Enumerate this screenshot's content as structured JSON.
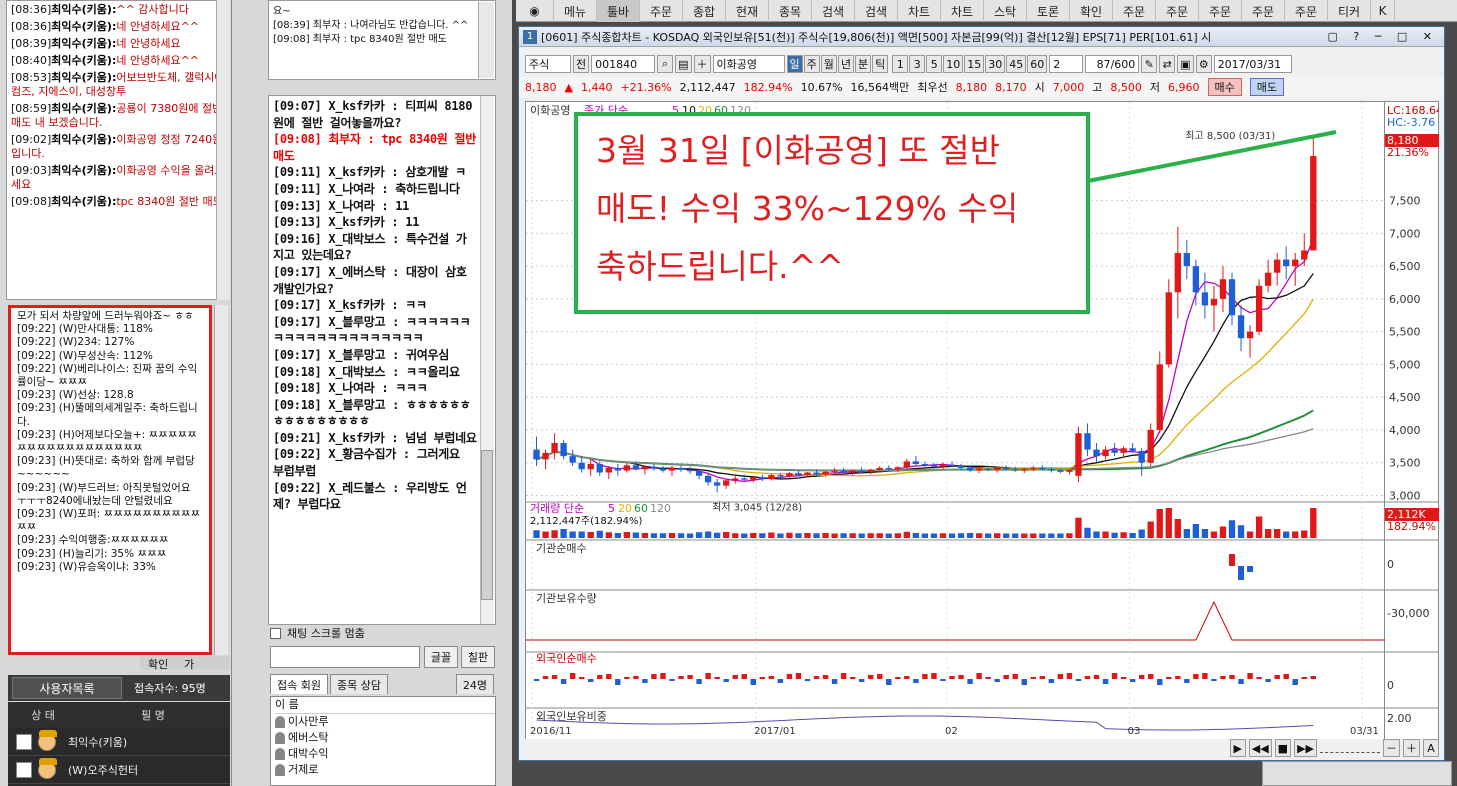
{
  "left_chat": {
    "messages": [
      {
        "time": "[08:36]",
        "name": "최익수(키움):",
        "text": "^^ 감사합니다"
      },
      {
        "time": "[08:36]",
        "name": "최익수(키움):",
        "text": "네 안녕하세요^^"
      },
      {
        "time": "[08:39]",
        "name": "최익수(키움):",
        "text": "네 안녕하세요"
      },
      {
        "time": "[08:40]",
        "name": "최익수(키움):",
        "text": "네 안녕하세요^^"
      },
      {
        "time": "[08:53]",
        "name": "최익수(키움):",
        "text": "어보브반도체, 갤럭시아컴즈, 지에스이, 대성창투"
      },
      {
        "time": "[08:59]",
        "name": "최익수(키움):",
        "text": "공룡이 7380원에 절반 매도 내 보겠습니다."
      },
      {
        "time": "[09:02]",
        "name": "최익수(키움):",
        "text": "이화공영 정정 7240원 입니다."
      },
      {
        "time": "[09:03]",
        "name": "최익수(키움):",
        "text": "이화공영 수익을 올려보세요"
      },
      {
        "time": "[09:08]",
        "name": "최익수(키움):",
        "text": "tpc 8340원 절반 매도"
      }
    ]
  },
  "highlight_chat": {
    "messages": [
      "모가 되서 차량앞에 드러누워야죠~ ㅎㅎ",
      "[09:22] (W)만사대통: 118%",
      "[09:22] (W)234: 127%",
      "[09:22] (W)무성산속: 112%",
      "[09:22] (W)베리나이스: 진짜 꿈의 수익률이당~ ㅉㅉㅉ",
      "[09:23] (W)선상: 128.8",
      "[09:23] (H)뚤메의세계일주: 축하드립니다.",
      "[09:23] (H)어제보다오늘+: ㅉㅉㅉㅉㅉㅉㅉㅉㅉㅉㅉㅉㅉㅉㅉㅉㅉㅉ",
      "[09:23] (H)뜻대로: 축하와 함께 부럽당~~~~~~",
      "[09:23] (W)부드러브: 아직못털었어요 ㅜㅜㅜ8240에내놨는데 안털렸네요",
      "[09:23] (W)포퍼: ㅉㅉㅉㅉㅉㅉㅉㅉㅉㅉㅉㅉ",
      "[09:23] 수익여행중:ㅉㅉㅉㅉㅉㅉ",
      "[09:23] (H)늘리기: 35% ㅉㅉㅉ",
      "[09:23] (W)유승옥이냐: 33%"
    ]
  },
  "user_panel": {
    "tab": "사용자목록",
    "count": "접속자수: 95명",
    "col_status": "상 태",
    "col_name": "필 명",
    "users": [
      "최익수(키움)",
      "(W)오주식헌터"
    ],
    "btn_a": "확인",
    "btn_b": "가"
  },
  "mid_top_chat": {
    "lines": [
      "요~",
      "[08:39] 최부자 : 나여라님도 반갑습니다. ^^",
      "[09:08] 최부자 : tpc 8340원 절반 매도"
    ]
  },
  "mid_chat": {
    "lines": [
      {
        "t": "[09:07] X_ksf카카 : 티피씨 8180원에 절반 걸어놓을까요?",
        "red": false
      },
      {
        "t": "[09:08] 최부자 : tpc 8340원 절반 매도",
        "red": true
      },
      {
        "t": "[09:11] X_ksf카카 : 삼호개발 ㅋ",
        "red": false
      },
      {
        "t": "[09:11] X_나여라 : 축하드립니다",
        "red": false
      },
      {
        "t": "[09:13] X_나여라 : 11",
        "red": false
      },
      {
        "t": "[09:13] X_ksf카카 : 11",
        "red": false
      },
      {
        "t": "[09:16] X_대박보스 : 특수건설 가지고 있는데요?",
        "red": false
      },
      {
        "t": "[09:17] X_에버스탁 : 대장이 삼호개발인가요?",
        "red": false
      },
      {
        "t": "[09:17] X_ksf카카 : ㅋㅋ",
        "red": false
      },
      {
        "t": "[09:17] X_블루망고 : ㅋㅋㅋㅋㅋㅋㅋㅋㅋㅋㅋㅋㅋㅋㅋㅋㅋㅋㅋㅋ",
        "red": false
      },
      {
        "t": "[09:17] X_블루망고 : 귀여우심",
        "red": false
      },
      {
        "t": "[09:18] X_대박보스 : ㅋㅋ올리요",
        "red": false
      },
      {
        "t": "[09:18] X_나여라 : ㅋㅋㅋ",
        "red": false
      },
      {
        "t": "[09:18] X_블루망고 : ㅎㅎㅎㅎㅎㅎㅎㅎㅎㅎㅎㅎㅎㅎㅎ",
        "red": false
      },
      {
        "t": "[09:21] X_ksf카카 : 넘넘 부럽네요",
        "red": false
      },
      {
        "t": "[09:22] X_황금수집가 : 그러게요 부럽부럽",
        "red": false
      },
      {
        "t": "[09:22] X_레드불스 : 우리방도 언제? 부럽다요",
        "red": false
      }
    ]
  },
  "chat_controls": {
    "lock_label": "채팅 스크롤 멈춤",
    "btn_font": "글꼴",
    "btn_board": "칠판",
    "tab_members": "접속 회원",
    "tab_consult": "종목 상담",
    "member_count": "24명",
    "member_header": "이 름",
    "members": [
      "이사만루",
      "에버스탁",
      "대박수익",
      "거제로"
    ]
  },
  "top_menu": {
    "items": [
      "메뉴",
      "툴바",
      "주문",
      "종합",
      "현재",
      "종목",
      "검색",
      "검색",
      "차트",
      "차트",
      "스탁",
      "토론",
      "확인",
      "주문",
      "주문",
      "주문",
      "주문",
      "주문",
      "티커",
      "K"
    ]
  },
  "chart_window": {
    "title": "[0601] 주식종합차트 - KOSDAQ 외국인보유[51(천)] 주식수[19,806(천)] 액면[500] 자본금[99(억)] 결산[12월] EPS[71] PER[101.61] 시",
    "win_num": "1",
    "toolbar": {
      "type": "주식",
      "prev": "전",
      "code": "001840",
      "stock": "이화공영",
      "periods": [
        "일",
        "주",
        "월",
        "년",
        "분",
        "틱"
      ],
      "nums": [
        "1",
        "3",
        "5",
        "10",
        "15",
        "30",
        "45",
        "60"
      ],
      "sel": "2",
      "count": "87/600",
      "date": "2017/03/31"
    },
    "quote": {
      "price": "8,180",
      "change": "1,440",
      "pct": "+21.36%",
      "volume": "2,112,447",
      "vol_pct": "182.94%",
      "turnover": "10.67%",
      "mcap": "16,564백만",
      "bid_label": "최우선",
      "bid1": "8,180",
      "bid2": "8,170",
      "open_label": "시",
      "open": "7,000",
      "high_label": "고",
      "high": "8,500",
      "low_label": "저",
      "low": "6,960",
      "buy": "매수",
      "sell": "매도"
    },
    "price_panel": {
      "label": "이화공영",
      "ma_label": "종가 단순",
      "ma5": "5",
      "ma10": "10",
      "ma20": "20",
      "ma60": "60",
      "ma120": "120",
      "high_note": "최고 8,500 (03/31)",
      "low_note": "최저 3,045 (12/28)",
      "lc": "LC:168.64",
      "hc": "HC:-3.76",
      "cur": "8,180",
      "cur_pct": "21.36%"
    },
    "vol_panel": {
      "label": "거래량 단순",
      "ma5": "5",
      "ma20": "20",
      "ma60": "60",
      "ma120": "120",
      "value": "2,112,447주(182.94%)",
      "cur": "2,112K",
      "cur_pct": "182.94%"
    },
    "panels": [
      "기관순매수",
      "기관보유수량",
      "외국인순매수",
      "외국인보유비중"
    ],
    "panel_ticks": [
      "0",
      "-30,000",
      "0",
      "2.00"
    ],
    "x_labels": [
      "2016/11",
      "2017/01",
      "02",
      "03",
      "03/31"
    ],
    "callout": [
      "3월 31일 [이화공영] 또 절반",
      "매도! 수익 33%~129% 수익",
      "축하드립니다.^^"
    ]
  },
  "colors": {
    "up": "#e01818",
    "down": "#1f5fd6",
    "callout_border": "#2bb04a",
    "callout_text": "#e02020",
    "highlight": "#e41b1b"
  },
  "chart_data": {
    "type": "candlestick",
    "title": "이화공영",
    "ylim": [
      2900,
      8700
    ],
    "y_ticks": [
      3000,
      3500,
      4000,
      4500,
      5000,
      5500,
      6000,
      6500,
      7000,
      7500
    ],
    "x_ticks": [
      "2016/11",
      "2017/01",
      "02",
      "03",
      "03/31"
    ],
    "candles": [
      [
        3700,
        3900,
        3450,
        3550
      ],
      [
        3550,
        3700,
        3400,
        3650
      ],
      [
        3650,
        3950,
        3550,
        3800
      ],
      [
        3800,
        3850,
        3550,
        3600
      ],
      [
        3600,
        3700,
        3450,
        3500
      ],
      [
        3500,
        3600,
        3350,
        3400
      ],
      [
        3400,
        3550,
        3300,
        3480
      ],
      [
        3480,
        3520,
        3300,
        3350
      ],
      [
        3350,
        3450,
        3250,
        3420
      ],
      [
        3420,
        3480,
        3300,
        3380
      ],
      [
        3380,
        3500,
        3350,
        3460
      ],
      [
        3460,
        3520,
        3380,
        3400
      ],
      [
        3400,
        3460,
        3320,
        3440
      ],
      [
        3440,
        3480,
        3380,
        3410
      ],
      [
        3410,
        3450,
        3350,
        3380
      ],
      [
        3380,
        3450,
        3300,
        3420
      ],
      [
        3420,
        3460,
        3360,
        3390
      ],
      [
        3390,
        3440,
        3330,
        3370
      ],
      [
        3370,
        3400,
        3250,
        3300
      ],
      [
        3300,
        3350,
        3150,
        3200
      ],
      [
        3200,
        3250,
        3045,
        3150
      ],
      [
        3150,
        3250,
        3100,
        3230
      ],
      [
        3230,
        3300,
        3180,
        3260
      ],
      [
        3260,
        3320,
        3200,
        3240
      ],
      [
        3240,
        3300,
        3200,
        3280
      ],
      [
        3280,
        3320,
        3220,
        3250
      ],
      [
        3250,
        3330,
        3230,
        3310
      ],
      [
        3310,
        3340,
        3260,
        3290
      ],
      [
        3290,
        3360,
        3270,
        3340
      ],
      [
        3340,
        3380,
        3290,
        3310
      ],
      [
        3310,
        3360,
        3280,
        3350
      ],
      [
        3350,
        3400,
        3300,
        3320
      ],
      [
        3320,
        3370,
        3290,
        3360
      ],
      [
        3360,
        3420,
        3320,
        3380
      ],
      [
        3380,
        3420,
        3330,
        3350
      ],
      [
        3350,
        3400,
        3300,
        3380
      ],
      [
        3380,
        3430,
        3340,
        3360
      ],
      [
        3360,
        3410,
        3320,
        3390
      ],
      [
        3390,
        3450,
        3350,
        3420
      ],
      [
        3420,
        3460,
        3370,
        3400
      ],
      [
        3400,
        3450,
        3360,
        3430
      ],
      [
        3430,
        3560,
        3400,
        3520
      ],
      [
        3520,
        3600,
        3450,
        3480
      ],
      [
        3480,
        3520,
        3420,
        3460
      ],
      [
        3460,
        3500,
        3400,
        3440
      ],
      [
        3440,
        3500,
        3400,
        3470
      ],
      [
        3470,
        3520,
        3430,
        3450
      ],
      [
        3450,
        3480,
        3380,
        3420
      ],
      [
        3420,
        3460,
        3360,
        3380
      ],
      [
        3380,
        3430,
        3340,
        3410
      ],
      [
        3410,
        3450,
        3370,
        3390
      ],
      [
        3390,
        3440,
        3350,
        3420
      ],
      [
        3420,
        3460,
        3380,
        3400
      ],
      [
        3400,
        3440,
        3360,
        3380
      ],
      [
        3380,
        3420,
        3340,
        3400
      ],
      [
        3400,
        3450,
        3370,
        3420
      ],
      [
        3420,
        3460,
        3380,
        3400
      ],
      [
        3400,
        3430,
        3350,
        3380
      ],
      [
        3380,
        3410,
        3340,
        3360
      ],
      [
        3360,
        3400,
        3320,
        3390
      ],
      [
        3300,
        4050,
        3200,
        3950
      ],
      [
        3950,
        4100,
        3600,
        3700
      ],
      [
        3700,
        3800,
        3500,
        3600
      ],
      [
        3600,
        3750,
        3550,
        3700
      ],
      [
        3700,
        3800,
        3600,
        3650
      ],
      [
        3650,
        3750,
        3580,
        3720
      ],
      [
        3720,
        3800,
        3650,
        3680
      ],
      [
        3680,
        3720,
        3300,
        3500
      ],
      [
        3500,
        4100,
        3450,
        4000
      ],
      [
        4000,
        5200,
        3950,
        5000
      ],
      [
        5000,
        6300,
        4950,
        6100
      ],
      [
        6100,
        7100,
        5700,
        6700
      ],
      [
        6700,
        6900,
        6300,
        6500
      ],
      [
        6500,
        6600,
        5900,
        6100
      ],
      [
        6100,
        6400,
        5700,
        5900
      ],
      [
        5900,
        6200,
        5500,
        6000
      ],
      [
        6000,
        6500,
        5800,
        6300
      ],
      [
        6300,
        6400,
        5600,
        5750
      ],
      [
        5750,
        5900,
        5200,
        5400
      ],
      [
        5400,
        5600,
        5100,
        5500
      ],
      [
        5500,
        6300,
        5450,
        6200
      ],
      [
        6200,
        6600,
        6100,
        6400
      ],
      [
        6400,
        6700,
        6200,
        6600
      ],
      [
        6600,
        6800,
        6300,
        6500
      ],
      [
        6500,
        6700,
        6200,
        6600
      ],
      [
        6600,
        7000,
        6500,
        6740
      ],
      [
        6740,
        8500,
        6960,
        8180
      ]
    ]
  }
}
